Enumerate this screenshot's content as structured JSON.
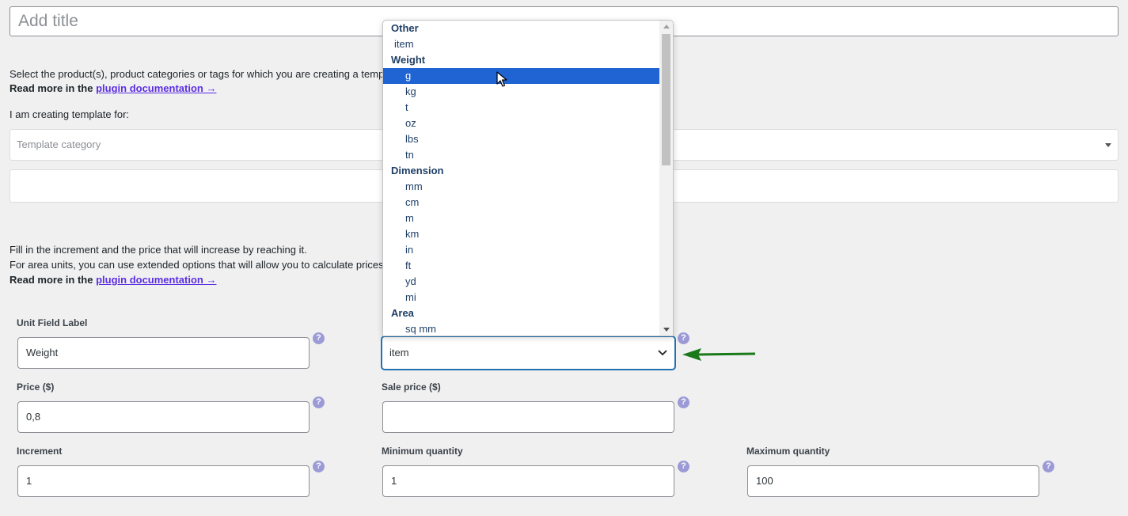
{
  "title_placeholder": "Add title",
  "intro": {
    "text": "Select the product(s), product categories or tags for which you are creating a temp",
    "read_more_prefix": "Read more in the",
    "link": "plugin documentation →"
  },
  "template_for_label": "I am creating template for:",
  "template_category_placeholder": "Template category",
  "info": {
    "line1": "Fill in the increment and the price that will increase by reaching it.",
    "line2": "For area units, you can use extended options that will allow you to calculate prices",
    "read_more_prefix": "Read more in the",
    "link": "plugin documentation →"
  },
  "fields": {
    "unit_label": {
      "label": "Unit Field Label",
      "value": "Weight"
    },
    "unit_select": {
      "value": "item"
    },
    "price": {
      "label": "Price ($)",
      "value": "0,8"
    },
    "sale_price": {
      "label": "Sale price ($)",
      "value": ""
    },
    "increment": {
      "label": "Increment",
      "value": "1"
    },
    "min_qty": {
      "label": "Minimum quantity",
      "value": "1"
    },
    "max_qty": {
      "label": "Maximum quantity",
      "value": "100"
    }
  },
  "help_glyph": "?",
  "dropdown": {
    "groups": [
      {
        "name": "Other",
        "options": [
          "item"
        ]
      },
      {
        "name": "Weight",
        "options": [
          "g",
          "kg",
          "t",
          "oz",
          "lbs",
          "tn"
        ]
      },
      {
        "name": "Dimension",
        "options": [
          "mm",
          "cm",
          "m",
          "km",
          "in",
          "ft",
          "yd",
          "mi"
        ]
      },
      {
        "name": "Area",
        "options": [
          "sq mm"
        ]
      }
    ],
    "selected": "g"
  },
  "colors": {
    "accent": "#2271b1",
    "selected_option": "#1f64d2",
    "arrow": "#1a7a1a",
    "link": "#5b2ee0"
  }
}
